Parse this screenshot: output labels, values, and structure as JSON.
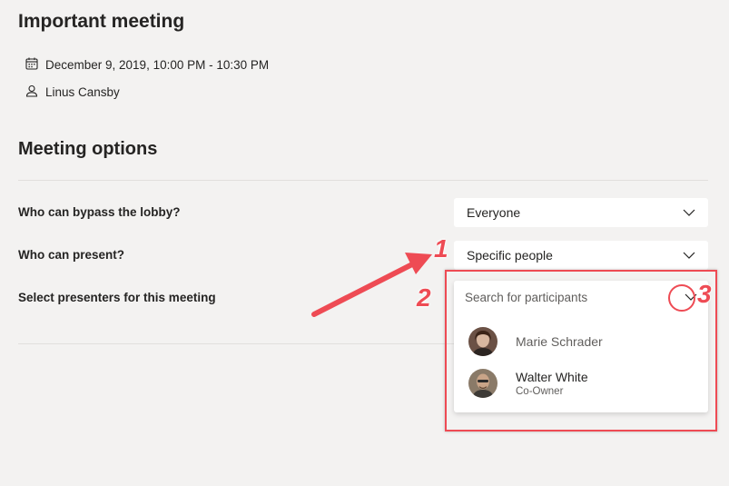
{
  "meeting": {
    "title": "Important meeting",
    "date": "December 9, 2019, 10:00 PM - 10:30 PM",
    "organizer": "Linus Cansby"
  },
  "options": {
    "section_title": "Meeting options",
    "lobby": {
      "label": "Who can bypass the lobby?",
      "value": "Everyone"
    },
    "presenters": {
      "label": "Who can present?",
      "value": "Specific people"
    },
    "select_presenters": {
      "label": "Select presenters for this meeting",
      "placeholder": "Search for participants"
    },
    "people": [
      {
        "name": "Marie Schrader",
        "role": ""
      },
      {
        "name": "Walter White",
        "role": "Co-Owner"
      }
    ]
  },
  "annotations": {
    "n1": "1",
    "n2": "2",
    "n3": "3"
  },
  "colors": {
    "background": "#f3f2f1",
    "annotation": "#ee4b54",
    "text": "#252423"
  },
  "icons": [
    "calendar-icon",
    "person-icon",
    "chevron-down-icon"
  ]
}
